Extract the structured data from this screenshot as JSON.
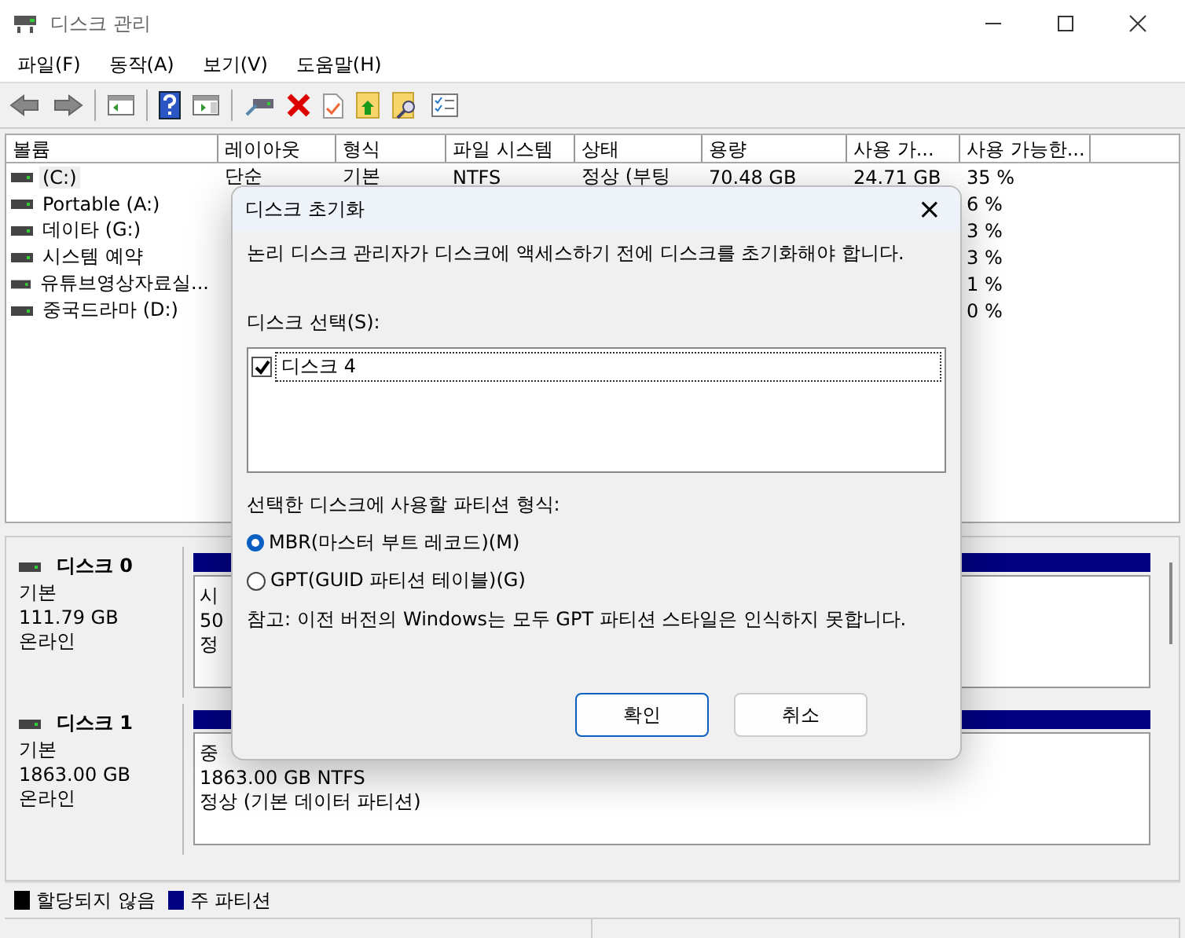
{
  "window": {
    "title": "디스크 관리"
  },
  "menu": [
    "파일(F)",
    "동작(A)",
    "보기(V)",
    "도움말(H)"
  ],
  "table": {
    "columns": [
      "볼륨",
      "레이아웃",
      "형식",
      "파일 시스템",
      "상태",
      "용량",
      "사용 가...",
      "사용 가능한..."
    ],
    "rows": [
      {
        "cells": [
          "(C:)",
          "단순",
          "기본",
          "NTFS",
          "정상 (부팅",
          "70.48 GB",
          "24.71 GB",
          "35 %"
        ],
        "selected": true
      },
      {
        "cells": [
          "Portable (A:)",
          "",
          "",
          "",
          "",
          "",
          "",
          "6 %"
        ],
        "selected": false
      },
      {
        "cells": [
          "데이타 (G:)",
          "",
          "",
          "",
          "",
          "",
          "",
          "3 %"
        ],
        "selected": false
      },
      {
        "cells": [
          "시스템 예약",
          "",
          "",
          "",
          "",
          "",
          "",
          "3 %"
        ],
        "selected": false
      },
      {
        "cells": [
          "유튜브영상자료실...",
          "",
          "",
          "",
          "",
          "",
          "",
          "1 %"
        ],
        "selected": false
      },
      {
        "cells": [
          "중국드라마 (D:)",
          "",
          "",
          "",
          "",
          "",
          "",
          "0 %"
        ],
        "selected": false
      }
    ]
  },
  "disks": [
    {
      "name": "디스크 0",
      "type": "기본",
      "size": "111.79 GB",
      "status": "온라인",
      "partition_lines": [
        "시",
        "50",
        "정"
      ]
    },
    {
      "name": "디스크 1",
      "type": "기본",
      "size": "1863.00 GB",
      "status": "온라인",
      "partition_lines": [
        "중",
        "1863.00 GB NTFS",
        "정상 (기본 데이터 파티션)"
      ]
    }
  ],
  "legend": [
    {
      "label": "할당되지 않음",
      "color": "#000000"
    },
    {
      "label": "주 파티션",
      "color": "#000080"
    }
  ],
  "dialog": {
    "title": "디스크 초기화",
    "close": "×",
    "message": "논리 디스크 관리자가 디스크에 액세스하기 전에 디스크를 초기화해야 합니다.",
    "select_label": "디스크 선택(S):",
    "disks": [
      {
        "label": "디스크 4",
        "checked": true
      }
    ],
    "partition_label": "선택한 디스크에 사용할 파티션 형식:",
    "options": [
      {
        "label": "MBR(마스터 부트 레코드)(M)",
        "selected": true
      },
      {
        "label": "GPT(GUID 파티션 테이블)(G)",
        "selected": false
      }
    ],
    "note": "참고: 이전 버전의 Windows는 모두 GPT 파티션 스타일은 인식하지 못합니다.",
    "buttons": [
      {
        "label": "확인",
        "kind": "default"
      },
      {
        "label": "취소",
        "kind": "normal"
      }
    ]
  }
}
